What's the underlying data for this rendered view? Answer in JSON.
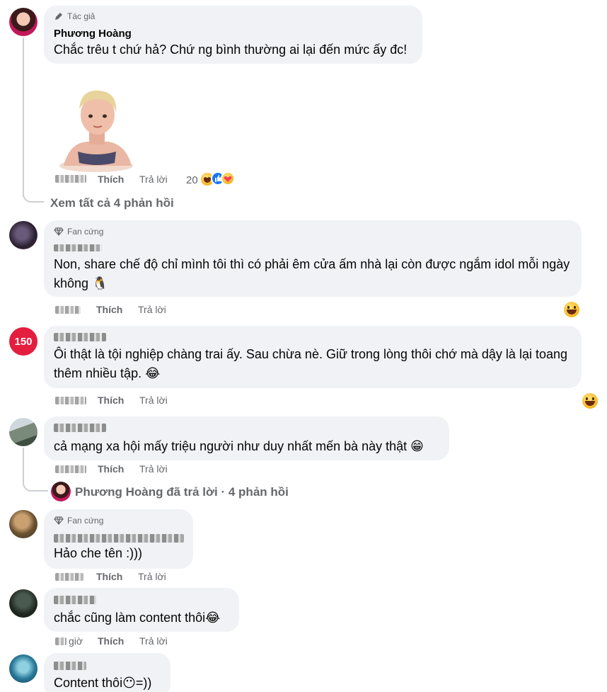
{
  "comments": {
    "c1": {
      "badge": "Tác giả",
      "name": "Phương Hoàng",
      "text": "Chắc trêu t chứ hả? Chứ ng bình thường ai lại đến mức ấy đc!",
      "like": "Thích",
      "reply": "Trả lời",
      "reaction_count": "20",
      "view_replies": "Xem tất cả 4 phản hồi"
    },
    "c2": {
      "badge": "Fan cứng",
      "text": "Non, share chế độ chỉ mình tôi thì có phải êm cửa ấm nhà lại còn được ngắm idol mỗi ngày không 🐧",
      "like": "Thích",
      "reply": "Trả lời"
    },
    "c3": {
      "text": "Ôi thật là tội nghiệp chàng trai ấy. Sau chừa nè. Giữ trong lòng thôi chớ mà dậy là lại toang thêm nhiều tập. 😂",
      "like": "Thích",
      "reply": "Trả lời",
      "avatar_label": "150"
    },
    "c4": {
      "text": "cả mạng xa hội mấy triệu người như duy nhất mến bà này thật 😁",
      "like": "Thích",
      "reply": "Trả lời",
      "replied_by": "Phương Hoàng đã trả lời · 4 phản hồi"
    },
    "c5": {
      "badge": "Fan cứng",
      "text": "Hảo che tên :)))",
      "like": "Thích",
      "reply": "Trả lời"
    },
    "c6": {
      "text": "chắc cũng làm content thôi😂",
      "time_suffix": "giờ",
      "like": "Thích",
      "reply": "Trả lời"
    },
    "c7": {
      "text": "Content thôi😶=))"
    }
  },
  "colors": {
    "bubble": "#f0f2f5",
    "secondary_text": "#65676b",
    "primary_text": "#050505",
    "like_blue": "#1877f2"
  }
}
